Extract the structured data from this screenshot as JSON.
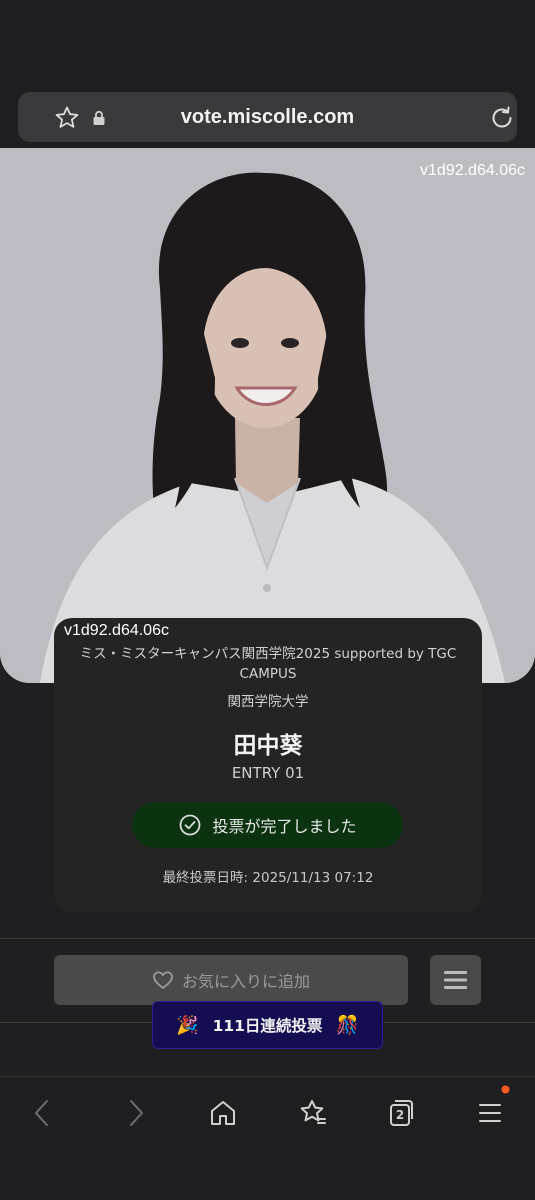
{
  "browser": {
    "url": "vote.miscolle.com",
    "icons": [
      "star-icon",
      "lock-icon",
      "reload-icon"
    ]
  },
  "version_label": "v1d92.d64.06c",
  "card": {
    "version_label": "v1d92.d64.06c",
    "contest": "ミス・ミスターキャンパス関西学院2025 supported by TGC CAMPUS",
    "university": "関西学院大学",
    "name": "田中葵",
    "entry": "ENTRY 01",
    "vote_status": "投票が完了しました",
    "last_vote": "最終投票日時: 2025/11/13 07:12"
  },
  "actions": {
    "favorite_label": "お気に入りに追加"
  },
  "streak": {
    "label": "111日連続投票",
    "emoji_left": "🎉",
    "emoji_right": "🎊"
  },
  "navbar": {
    "tab_count": "2"
  },
  "colors": {
    "background": "#1f1f21",
    "card": "#242424",
    "vote_done": "#0c3310",
    "streak": "#140d52",
    "badge": "#ff5a1f"
  }
}
